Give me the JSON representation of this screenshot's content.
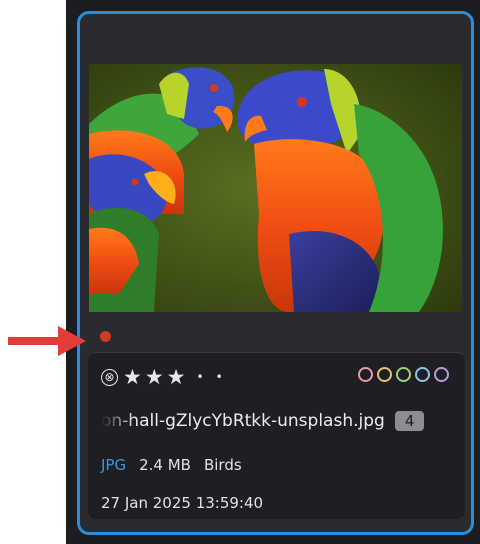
{
  "card": {
    "filename": "on-hall-gZlycYbRtkk-unsplash.jpg",
    "stack_count": "4",
    "file_type": "JPG",
    "file_size": "2.4 MB",
    "folder": "Birds",
    "datetime": "27 Jan 2025 13:59:40",
    "rating": 3,
    "rating_max": 5,
    "reject_symbol": "⊗",
    "star_symbol": "★",
    "unrated_symbol": "•",
    "color_label": "red",
    "color_label_hex": "#d23a22",
    "label_colors": [
      "#e79aa8",
      "#e6c36a",
      "#9fd07d",
      "#8fc3e8",
      "#b79bd9"
    ]
  },
  "theme": {
    "selection_border": "#2a8ed8",
    "arrow_color": "#e33d3a"
  },
  "icons": {
    "reject": "reject-icon",
    "star": "star-icon",
    "arrow": "red-arrow-pointer"
  }
}
